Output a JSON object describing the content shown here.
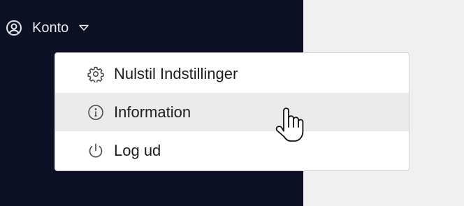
{
  "account": {
    "label": "Konto",
    "icon": "user-circle-icon",
    "caret": "caret-down-icon"
  },
  "menu": {
    "items": [
      {
        "label": "Nulstil Indstillinger",
        "icon": "gear-icon",
        "hovered": false
      },
      {
        "label": "Information",
        "icon": "info-icon",
        "hovered": true
      },
      {
        "label": "Log ud",
        "icon": "power-icon",
        "hovered": false
      }
    ]
  },
  "colors": {
    "sidebar": "#0b1122",
    "content": "#f0f0f0",
    "menu_bg": "#ffffff",
    "hover_bg": "#ebebeb"
  },
  "cursor": "hand-pointer-icon"
}
